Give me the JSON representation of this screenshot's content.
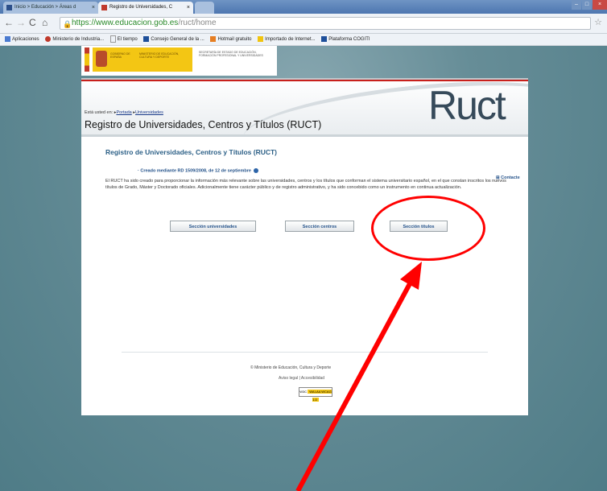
{
  "browser": {
    "tabs": [
      {
        "label": "Inicio > Educación > Áreas d"
      },
      {
        "label": "Registro de Universidades, C"
      }
    ],
    "url": {
      "host": "https://www.educacion.gob.es",
      "path": "/ruct/home"
    },
    "bookmarks": [
      {
        "label": "Aplicaciones"
      },
      {
        "label": "Ministerio de Industria..."
      },
      {
        "label": "El tiempo"
      },
      {
        "label": "Consejo General de la ..."
      },
      {
        "label": "Hotmail gratuito"
      },
      {
        "label": "Importado de Internet..."
      },
      {
        "label": "Plataforma COGITI"
      }
    ]
  },
  "banner": {
    "gobierno": "GOBIERNO DE ESPAÑA",
    "ministerio": "MINISTERIO DE EDUCACIÓN, CULTURA Y DEPORTE",
    "secretaria": "SECRETARÍA DE ESTADO DE EDUCACIÓN, FORMACIÓN PROFESIONAL Y UNIVERSIDADES"
  },
  "header": {
    "logo": "Ruct",
    "breadcrumb_prefix": "Está usted en:",
    "breadcrumb": [
      "Portada",
      "Universidades"
    ],
    "title": "Registro de Universidades, Centros y Títulos (RUCT)"
  },
  "main": {
    "heading": "Registro de Universidades, Centros y Títulos (RUCT)",
    "contact": "Contacte",
    "creado": "Creado mediante RD 1509/2008, de 12 de septiembre",
    "paragraph": "El RUCT ha sido creado para proporcionar la información más relevante sobre las universidades, centros y los títulos que conforman el sistema universitario español, en el que constan inscritos los nuevos títulos de Grado, Máster y Doctorado oficiales. Adicionalmente tiene carácter público y de registro administrativo, y ha sido concebido como un instrumento en continua actualización.",
    "buttons": {
      "universidades": "Sección universidades",
      "centros": "Sección centros",
      "titulos": "Sección títulos"
    }
  },
  "footer": {
    "copyright": "© Ministerio de Educación, Cultura y Deporte",
    "aviso": "Aviso legal",
    "accesibilidad": "Accesibilidad",
    "badge_w3c": "W3C",
    "badge_wai": "WAI-AA WCAG 1.0"
  },
  "colors": {
    "annotation": "#ff0000",
    "accent": "#24528a"
  }
}
